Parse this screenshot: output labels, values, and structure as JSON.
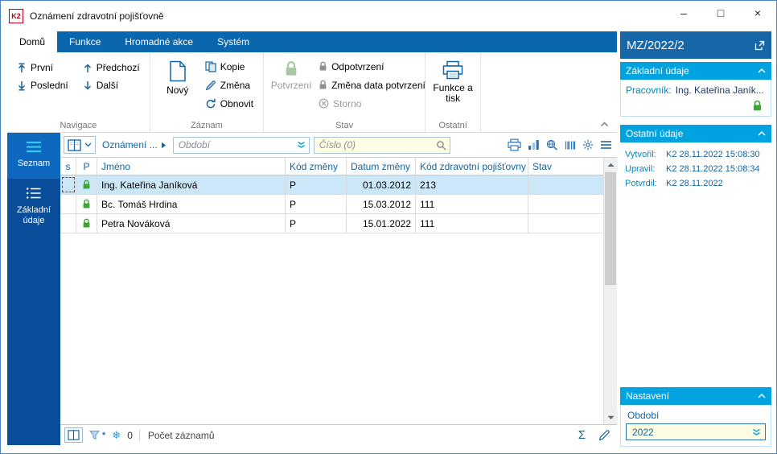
{
  "window": {
    "title": "Oznámení zdravotní pojišťovně",
    "logo": "K2",
    "controls": {
      "minimize": "–",
      "maximize": "□",
      "close": "×"
    }
  },
  "ribbon": {
    "tabs": [
      {
        "label": "Domů"
      },
      {
        "label": "Funkce"
      },
      {
        "label": "Hromadné akce"
      },
      {
        "label": "Systém"
      }
    ],
    "navigace": {
      "label": "Navigace",
      "prvni": "První",
      "posledni": "Poslední",
      "predchozi": "Předchozí",
      "dalsi": "Další"
    },
    "zaznam": {
      "label": "Záznam",
      "novy": "Nový",
      "kopie": "Kopie",
      "zmena": "Změna",
      "obnovit": "Obnovit"
    },
    "stav": {
      "label": "Stav",
      "potvrzeni": "Potvrzení",
      "odpotvrzeni": "Odpotvrzení",
      "zmena_data": "Změna data potvrzení",
      "storno": "Storno"
    },
    "ostatni": {
      "label": "Ostatní",
      "funkce_a_tisk": "Funkce a tisk"
    }
  },
  "sidebar": {
    "seznam": "Seznam",
    "zakladni_udaje": "Základní údaje"
  },
  "toolbar": {
    "view_label": "Oznámení ...",
    "period_placeholder": "Období",
    "search_placeholder": "Číslo (0)"
  },
  "table": {
    "headers": {
      "s": "s",
      "p": "P",
      "jmeno": "Jméno",
      "kod_zmeny": "Kód změny",
      "datum_zmeny": "Datum změny",
      "kod_pojistovny": "Kód zdravotní pojišťovny",
      "stav": "Stav"
    },
    "rows": [
      {
        "jmeno": "Ing. Kateřina Janíková",
        "kod_zmeny": "P",
        "datum_zmeny": "01.03.2012",
        "kod_pojistovny": "213",
        "stav": ""
      },
      {
        "jmeno": "Bc. Tomáš Hrdina",
        "kod_zmeny": "P",
        "datum_zmeny": "15.03.2012",
        "kod_pojistovny": "111",
        "stav": ""
      },
      {
        "jmeno": "Petra Nováková",
        "kod_zmeny": "P",
        "datum_zmeny": "15.01.2022",
        "kod_pojistovny": "111",
        "stav": ""
      }
    ]
  },
  "statusbar": {
    "frozen_count": "0",
    "records_label": "Počet záznamů",
    "sigma": "Σ",
    "snowflake": "❄",
    "filter_star": "*"
  },
  "right_panel": {
    "record_id": "MZ/2022/2",
    "zakladni": {
      "title": "Základní údaje",
      "pracovnik_label": "Pracovník:",
      "pracovnik_value": "Ing. Kateřina Janík..."
    },
    "ostatni": {
      "title": "Ostatní údaje",
      "vytvoril_label": "Vytvořil:",
      "vytvoril_value": "K2 28.11.2022 15:08:30",
      "upravil_label": "Upravil:",
      "upravil_value": "K2 28.11.2022 15:08:34",
      "potvrdil_label": "Potvrdil:",
      "potvrdil_value": "K2 28.11.2022"
    },
    "nastaveni": {
      "title": "Nastavení",
      "obdobi_label": "Období",
      "obdobi_value": "2022"
    }
  },
  "colors": {
    "ribbon_blue": "#0a66ad",
    "panel_blue": "#1766a8",
    "section_cyan": "#00a3e0",
    "link_blue": "#1464a0",
    "green_lock": "#3da535",
    "selected_row": "#cce7f8",
    "input_yellow": "#fffee4",
    "sidebar_blue": "#0a4e9b"
  }
}
